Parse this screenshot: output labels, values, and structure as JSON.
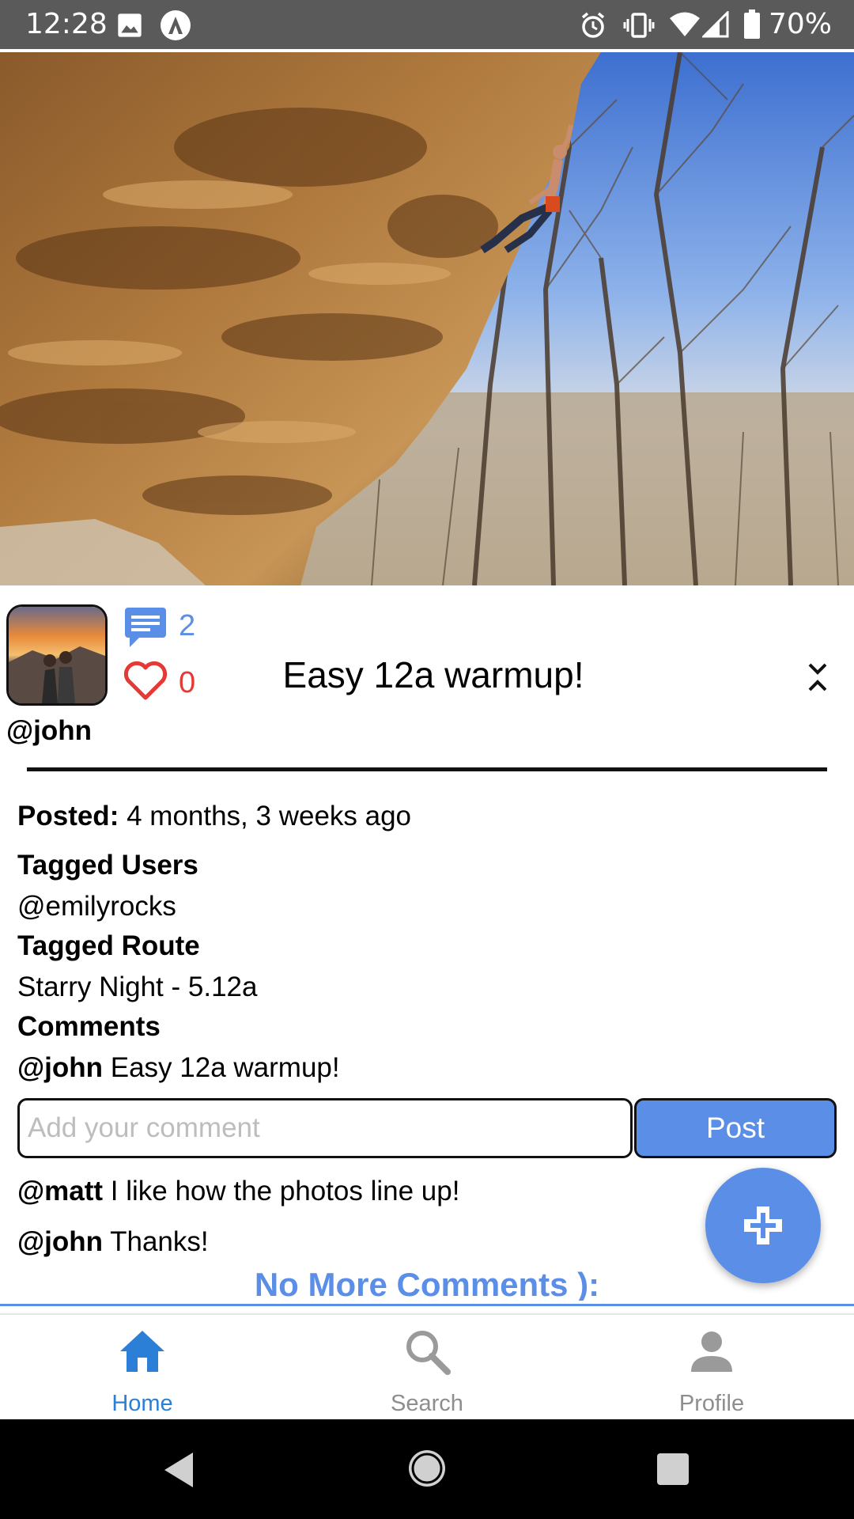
{
  "status_bar": {
    "time": "12:28",
    "battery": "70%"
  },
  "post": {
    "comment_count": "2",
    "like_count": "0",
    "title": "Easy 12a warmup!",
    "username": "@john",
    "posted_label": "Posted:",
    "posted_value": "4 months, 3 weeks ago",
    "tagged_users_label": "Tagged Users",
    "tagged_users_value": "@emilyrocks",
    "tagged_route_label": "Tagged Route",
    "tagged_route_value": "Starry Night - 5.12a",
    "comments_label": "Comments",
    "caption_user": "@john",
    "caption_text": "Easy 12a warmup!"
  },
  "comment_form": {
    "placeholder": "Add your comment",
    "post_label": "Post"
  },
  "comments": [
    {
      "user": "@matt",
      "text": "I like how the photos line up!"
    },
    {
      "user": "@john",
      "text": "Thanks!"
    }
  ],
  "no_more_comments": "No More Comments ):",
  "tabs": [
    {
      "label": "Home",
      "icon": "home-icon",
      "active": true
    },
    {
      "label": "Search",
      "icon": "search-icon",
      "active": false
    },
    {
      "label": "Profile",
      "icon": "person-icon",
      "active": false
    }
  ],
  "colors": {
    "accent": "#5b8ee6",
    "like": "#e53935",
    "tab_active": "#2b7fd6",
    "tab_inactive": "#8e8e8e"
  }
}
